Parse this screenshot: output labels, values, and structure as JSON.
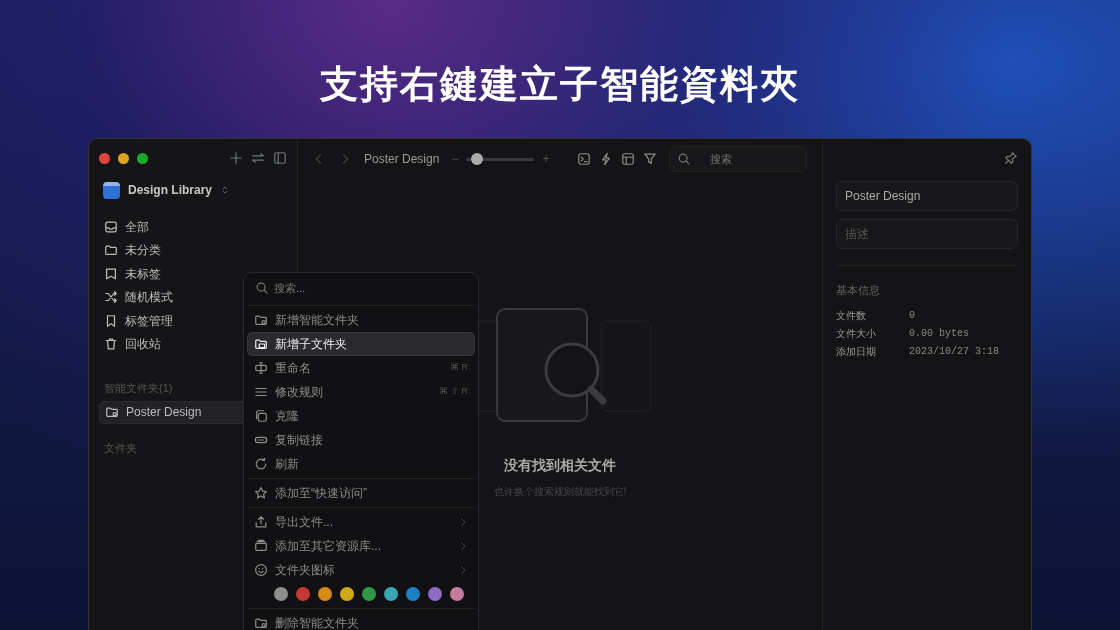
{
  "headline": "支持右鍵建立子智能資料夾",
  "sidebar": {
    "library": "Design Library",
    "items": [
      {
        "label": "全部",
        "selected": false
      },
      {
        "label": "未分类",
        "selected": false
      },
      {
        "label": "未标签",
        "selected": false
      },
      {
        "label": "随机模式",
        "selected": false
      },
      {
        "label": "标签管理",
        "selected": false
      },
      {
        "label": "回收站",
        "selected": false
      }
    ],
    "smart_section": "智能文件夹(1)",
    "smart_items": [
      {
        "label": "Poster Design",
        "selected": true
      }
    ],
    "folders_section": "文件夹"
  },
  "toolbar": {
    "title": "Poster Design",
    "zoom": {
      "minus": "−",
      "plus": "+",
      "level": 0.15
    },
    "search_placeholder": "搜索"
  },
  "empty_state": {
    "title": "没有找到相关文件",
    "subtitle": "也许换个搜索规则就能找到它!"
  },
  "inspector": {
    "name_value": "Poster Design",
    "description_placeholder": "描述",
    "section": "基本信息",
    "rows": [
      {
        "label": "文件数",
        "value": "0"
      },
      {
        "label": "文件大小",
        "value": "0.00 bytes"
      },
      {
        "label": "添加日期",
        "value": "2023/10/27 3:18"
      }
    ]
  },
  "context_menu": {
    "search_placeholder": "搜索...",
    "groups": [
      [
        {
          "kind": "item",
          "label": "新增智能文件夹",
          "selected": false
        },
        {
          "kind": "item",
          "label": "新增子文件夹",
          "selected": true
        },
        {
          "kind": "item",
          "label": "重命名",
          "shortcut": "⌘ R",
          "selected": false
        },
        {
          "kind": "item",
          "label": "修改规则",
          "shortcut": "⌘ ⇧ R",
          "selected": false
        },
        {
          "kind": "item",
          "label": "克隆",
          "selected": false
        },
        {
          "kind": "item",
          "label": "复制链接",
          "selected": false
        },
        {
          "kind": "item",
          "label": "刷新",
          "selected": false
        }
      ],
      [
        {
          "kind": "item",
          "label": "添加至“快速访问”",
          "selected": false
        }
      ],
      [
        {
          "kind": "item",
          "label": "导出文件...",
          "submenu": true,
          "selected": false
        },
        {
          "kind": "item",
          "label": "添加至其它资源库...",
          "submenu": true,
          "selected": false
        },
        {
          "kind": "item",
          "label": "文件夹图标",
          "submenu": true,
          "selected": false
        },
        {
          "kind": "colors",
          "swatches": [
            {
              "color": "#8e8e8e"
            },
            {
              "color": "#c43a30"
            },
            {
              "color": "#d68a12"
            },
            {
              "color": "#d1a817"
            },
            {
              "color": "#2f9a45"
            },
            {
              "color": "#3aa6b4"
            },
            {
              "color": "#1d7fc6"
            },
            {
              "color": "#8d6cc6"
            },
            {
              "color": "#c57c9e"
            }
          ]
        }
      ],
      [
        {
          "kind": "item",
          "label": "删除智能文件夹",
          "selected": false
        }
      ]
    ]
  }
}
